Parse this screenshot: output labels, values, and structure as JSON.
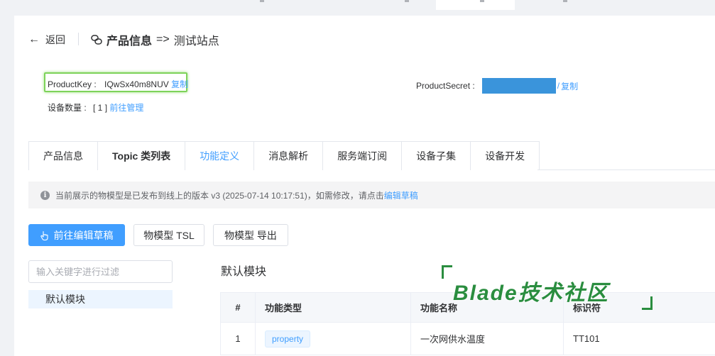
{
  "header": {
    "back_label": "返回",
    "title_main": "产品信息",
    "title_arrow": "=>",
    "title_site": "测试站点"
  },
  "product": {
    "key_label": "ProductKey :",
    "key_value": "IQwSx40m8NUV",
    "copy_label": "复制",
    "secret_label": "ProductSecret :",
    "secret_sep": "/",
    "secret_copy_label": "复制",
    "device_count_label": "设备数量 :",
    "device_count_value": "[ 1 ]",
    "device_manage_link": "前往管理"
  },
  "tabs": [
    {
      "label": "产品信息"
    },
    {
      "label": "Topic 类列表"
    },
    {
      "label": "功能定义"
    },
    {
      "label": "消息解析"
    },
    {
      "label": "服务端订阅"
    },
    {
      "label": "设备子集"
    },
    {
      "label": "设备开发"
    }
  ],
  "active_tab": "功能定义",
  "alert": {
    "icon": "info-icon",
    "text": "当前展示的物模型是已发布到线上的版本 v3 (2025-07-14 10:17:51)，如需修改，请点击",
    "link": "编辑草稿"
  },
  "buttons": {
    "edit_draft": "前往编辑草稿",
    "tsl": "物模型 TSL",
    "export": "物模型 导出"
  },
  "filter": {
    "placeholder": "输入关键字进行过滤"
  },
  "tree": {
    "items": [
      "默认模块"
    ]
  },
  "module": {
    "title": "默认模块"
  },
  "table": {
    "headers": [
      "#",
      "功能类型",
      "功能名称",
      "标识符"
    ],
    "rows": [
      {
        "index": "1",
        "type": "property",
        "name": "一次网供水温度",
        "identifier": "TT101"
      }
    ]
  },
  "watermark": {
    "text": "Blade技术社区"
  },
  "colors": {
    "accent": "#409eff",
    "highlight_border": "#7ed35a",
    "secret_mask": "#3a94db",
    "watermark": "#2a8d3f"
  }
}
